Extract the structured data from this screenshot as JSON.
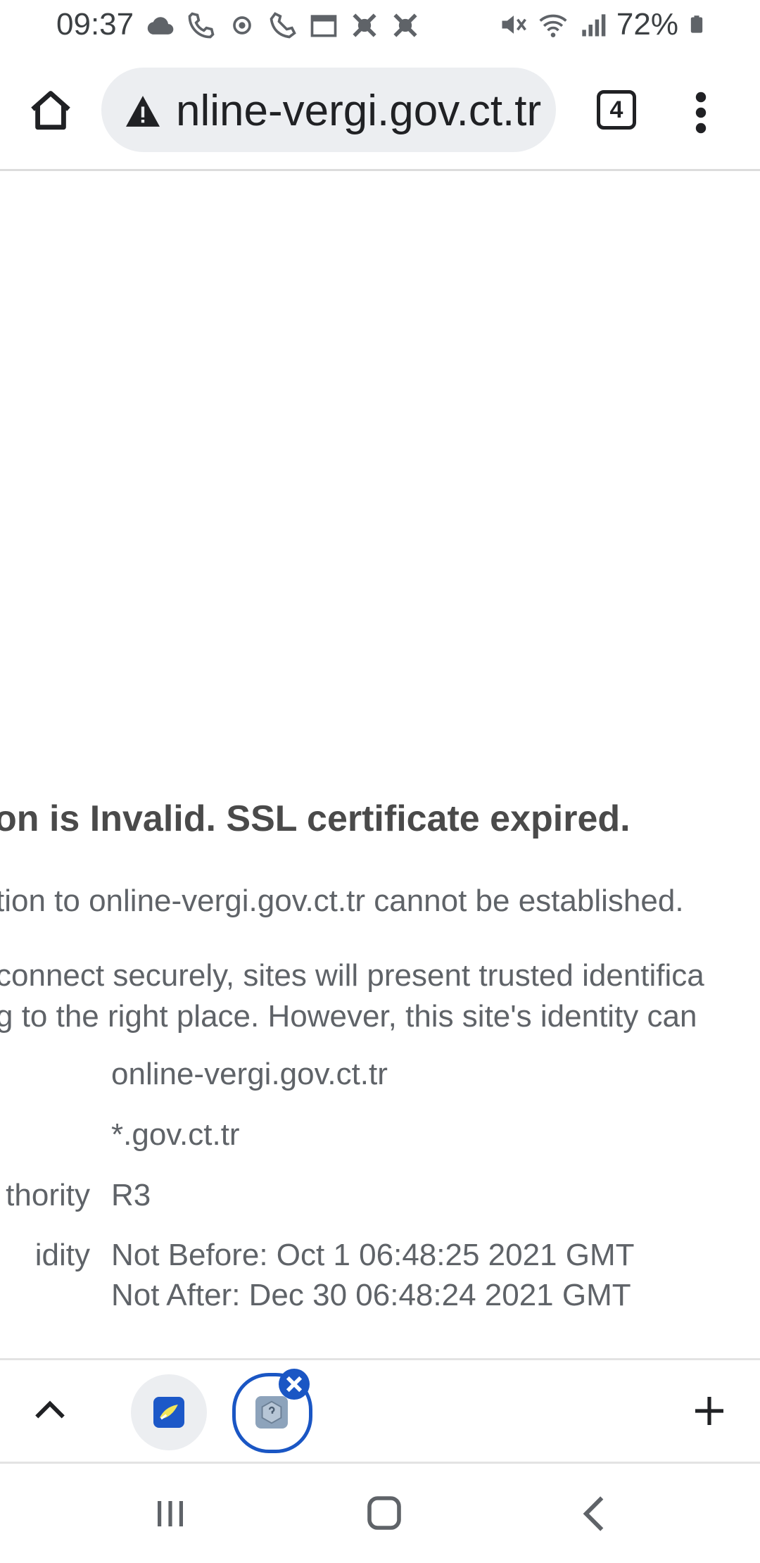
{
  "status_bar": {
    "time": "09:37",
    "battery": "72%",
    "icons": [
      "cloud-icon",
      "call-icon",
      "location-icon",
      "phone-icon",
      "calendar-icon",
      "app-icon",
      "app-icon",
      "mute-icon",
      "wifi-icon",
      "signal-icon",
      "battery-icon"
    ]
  },
  "toolbar": {
    "url": "nline-vergi.gov.ct.tr",
    "tab_count": "4"
  },
  "error_page": {
    "title": "on is Invalid. SSL certificate expired.",
    "paragraph1": "tion to online-vergi.gov.ct.tr cannot be established.",
    "paragraph2_line1": "connect securely, sites will present trusted identifica",
    "paragraph2_line2": "g to the right place. However, this site's identity can",
    "cert_rows": [
      {
        "label": "",
        "value": "online-vergi.gov.ct.tr"
      },
      {
        "label": "",
        "value": "*.gov.ct.tr"
      },
      {
        "label": "thority",
        "value": "R3"
      },
      {
        "label": "idity",
        "value": "Not Before: Oct 1 06:48:25 2021 GMT"
      },
      {
        "label": "",
        "value": "Not After: Dec 30 06:48:24 2021 GMT"
      }
    ]
  },
  "colors": {
    "accent": "#1a56c4",
    "pill_bg": "#eceef1"
  }
}
